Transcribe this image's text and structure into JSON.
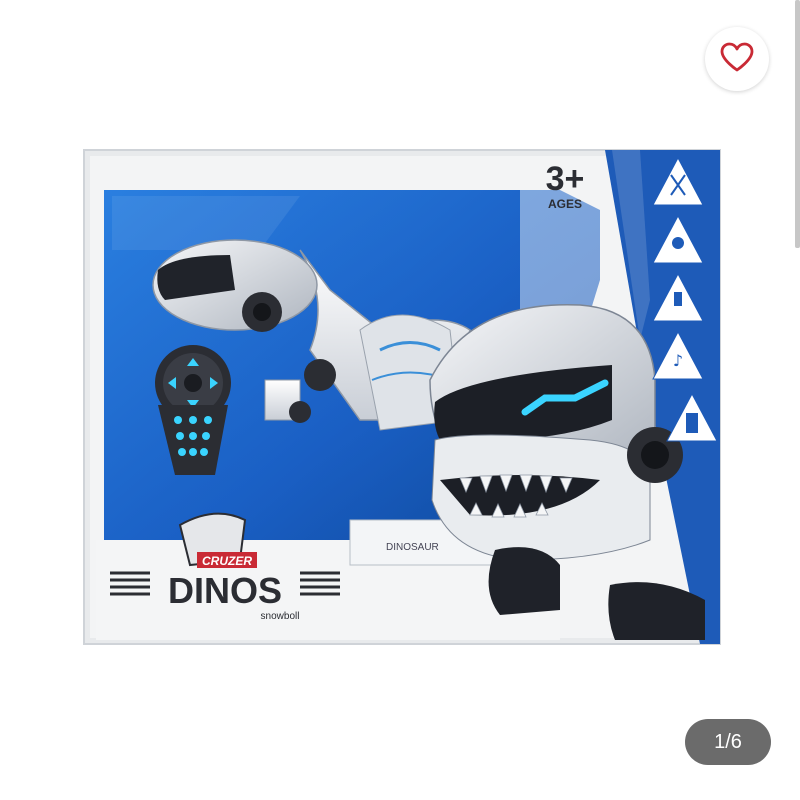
{
  "product": {
    "brand_top": "CRUZER",
    "brand_main": "DINOS",
    "brand_sub": "snowboll",
    "age_big": "3+",
    "age_small": "AGES",
    "box_label": "DINOSAUR"
  },
  "features": [
    {
      "icon": "walk-icon"
    },
    {
      "icon": "remote-icon"
    },
    {
      "icon": "led-icon"
    },
    {
      "icon": "music-icon"
    },
    {
      "icon": "battery-icon"
    }
  ],
  "gallery": {
    "counter": "1/6"
  },
  "colors": {
    "box_blue": "#1e5bb8",
    "box_white": "#f1f2f3",
    "accent_light_blue": "#3ad4ff",
    "counter_bg": "#6b6b6b",
    "heart_red": "#c92a35"
  }
}
